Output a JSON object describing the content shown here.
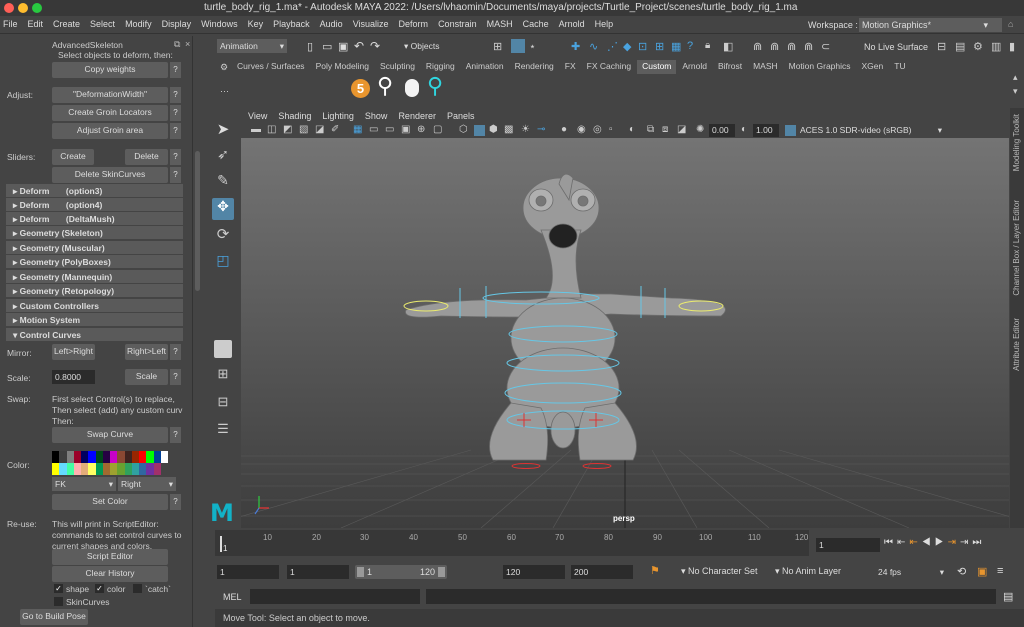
{
  "title": "turtle_body_rig_1.ma* - Autodesk MAYA 2022: /Users/lvhaomin/Documents/maya/projects/Turtle_Project/scenes/turtle_body_rig_1.ma",
  "menu": [
    "File",
    "Edit",
    "Create",
    "Select",
    "Modify",
    "Display",
    "Windows",
    "Key",
    "Playback",
    "Audio",
    "Visualize",
    "Deform",
    "Constrain",
    "MASH",
    "Cache",
    "Arnold",
    "Help"
  ],
  "workspace": {
    "label": "Workspace :",
    "value": "Motion Graphics*"
  },
  "status": {
    "menuset": "Animation",
    "objects": "Objects",
    "live": "No Live Surface"
  },
  "shelf_tabs": [
    "Curves / Surfaces",
    "Poly Modeling",
    "Sculpting",
    "Rigging",
    "Animation",
    "Rendering",
    "FX",
    "FX Caching",
    "Custom",
    "Arnold",
    "Bifrost",
    "MASH",
    "Motion Graphics",
    "XGen",
    "TU"
  ],
  "left": {
    "header": "AdvancedSkeleton",
    "select_hint": "Select objects to deform, then:",
    "copy_weights": "Copy weights",
    "adjust_label": "Adjust:",
    "deformation_width": "\"DeformationWidth\"",
    "create_groin": "Create Groin Locators",
    "adjust_groin": "Adjust Groin area",
    "sliders_label": "Sliders:",
    "create": "Create",
    "delete": "Delete",
    "delete_skincurves": "Delete SkinCurves",
    "frames": [
      "Deform       (option3)",
      "Deform       (option4)",
      "Deform       (DeltaMush)",
      "Geometry (Skeleton)",
      "Geometry (Muscular)",
      "Geometry (PolyBoxes)",
      "Geometry (Mannequin)",
      "Geometry (Retopology)",
      "Custom Controllers",
      "Motion System",
      "Control Curves"
    ],
    "mirror_label": "Mirror:",
    "left_right": "Left>Right",
    "right_left": "Right>Left",
    "scale_label": "Scale:",
    "scale_value": "0.8000",
    "scale_btn": "Scale",
    "swap_label": "Swap:",
    "swap_text": [
      "First select Control(s) to replace,",
      "Then select (add) any custom curv",
      "Then:"
    ],
    "swap_curve": "Swap Curve",
    "color_label": "Color:",
    "fk": "FK",
    "right": "Right",
    "set_color": "Set Color",
    "reuse_label": "Re-use:",
    "reuse_text": [
      "This will print in ScriptEditor:",
      "commands to set control curves to",
      "current shapes and colors."
    ],
    "script_editor": "Script Editor",
    "clear_history": "Clear History",
    "shape": "shape",
    "color": "color",
    "catch": "`catch`",
    "skincurves": "SkinCurves",
    "build_pose": "Go to Build Pose",
    "q": "?"
  },
  "panel_menu": [
    "View",
    "Shading",
    "Lighting",
    "Show",
    "Renderer",
    "Panels"
  ],
  "panel_tb": {
    "v1": "0.00",
    "v2": "1.00",
    "colorspace": "ACES 1.0 SDR-video (sRGB)"
  },
  "camera": "persp",
  "right_tabs": [
    "Modeling Toolkit",
    "Channel Box / Layer Editor",
    "Attribute Editor"
  ],
  "timeline": {
    "ticks": [
      "1",
      "10",
      "20",
      "30",
      "40",
      "50",
      "60",
      "70",
      "80",
      "90",
      "100",
      "110",
      "120"
    ],
    "current": "1"
  },
  "range": {
    "start": "1",
    "start2": "1",
    "slider_start": "1",
    "slider_end": "120",
    "end": "120",
    "end2": "200",
    "character": "No Character Set",
    "anim_layer": "No Anim Layer",
    "fps": "24 fps"
  },
  "cmd": {
    "label": "MEL"
  },
  "help": "Move Tool: Select an object to move."
}
